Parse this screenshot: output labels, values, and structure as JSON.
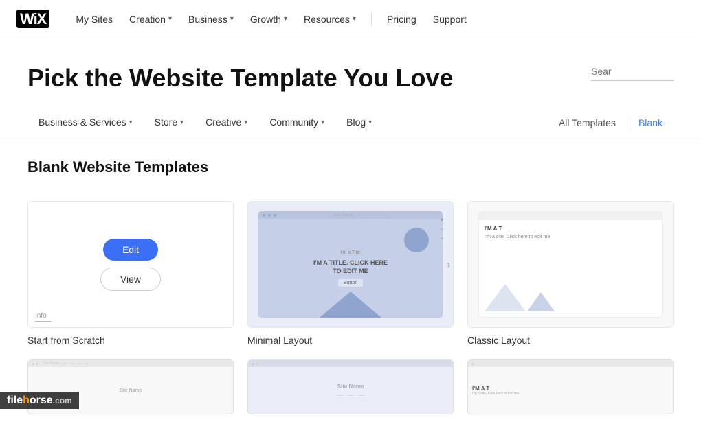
{
  "navbar": {
    "logo": "Wix",
    "items": [
      {
        "label": "My Sites",
        "hasDropdown": false
      },
      {
        "label": "Creation",
        "hasDropdown": true
      },
      {
        "label": "Business",
        "hasDropdown": true
      },
      {
        "label": "Growth",
        "hasDropdown": true
      },
      {
        "label": "Resources",
        "hasDropdown": true
      },
      {
        "label": "Pricing",
        "hasDropdown": false
      },
      {
        "label": "Support",
        "hasDropdown": false
      }
    ]
  },
  "hero": {
    "title": "Pick the Website Template You Love",
    "search_placeholder": "Sear"
  },
  "filter_bar": {
    "items": [
      {
        "label": "Business & Services",
        "hasDropdown": true
      },
      {
        "label": "Store",
        "hasDropdown": true
      },
      {
        "label": "Creative",
        "hasDropdown": true
      },
      {
        "label": "Community",
        "hasDropdown": true
      },
      {
        "label": "Blog",
        "hasDropdown": true
      }
    ],
    "right_items": [
      {
        "label": "All Templates",
        "active": false
      },
      {
        "label": "Blank",
        "active": true
      }
    ]
  },
  "section": {
    "title": "Blank Website Templates"
  },
  "templates": [
    {
      "name": "Start from Scratch",
      "type": "scratch"
    },
    {
      "name": "Minimal Layout",
      "type": "minimal"
    },
    {
      "name": "Classic Layout",
      "type": "classic"
    }
  ],
  "bottom_templates": [
    {
      "type": "site1",
      "sitename": "Site Name"
    },
    {
      "type": "site2",
      "sitename": "Site Name"
    },
    {
      "type": "site3",
      "sitename": "I'M A T"
    }
  ],
  "buttons": {
    "edit": "Edit",
    "view": "View"
  },
  "thumb_text": {
    "minimal_title": "I'M A TITLE. CLICK HERE TO EDIT ME",
    "minimal_small": "I'm a Title",
    "classic_title": "I'M A T",
    "classic_sub": "I'm a site, Click here to edit me"
  },
  "thumb_info": {
    "info_label": "Info"
  },
  "watermark": {
    "text": "filehor",
    "horse": "h",
    "rest": "orse",
    "com": ".com"
  }
}
